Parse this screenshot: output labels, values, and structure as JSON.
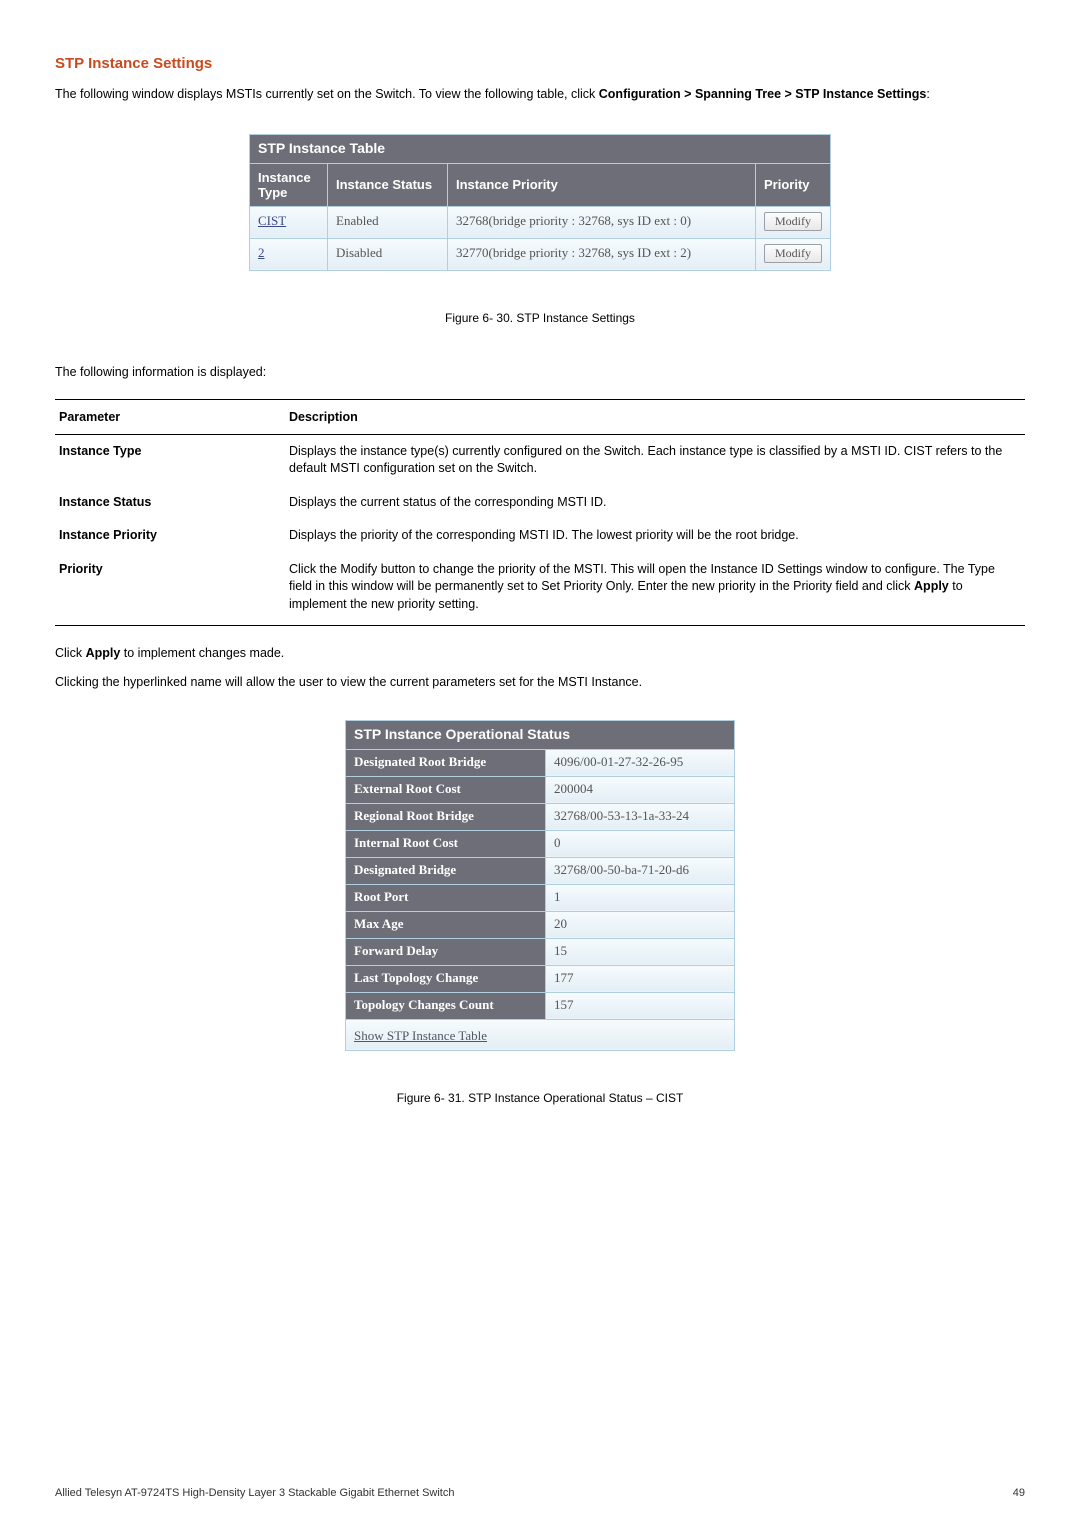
{
  "section": {
    "title": "STP Instance Settings",
    "intro_prefix": "The following window displays MSTIs currently set on the Switch. To view the following table, click ",
    "intro_bold": "Configuration > Spanning Tree > STP Instance Settings",
    "intro_suffix": ":"
  },
  "stp_instance_table": {
    "title": "STP Instance Table",
    "headers": {
      "instance_type": "Instance Type",
      "instance_status": "Instance Status",
      "instance_priority": "Instance Priority",
      "priority": "Priority"
    },
    "rows": [
      {
        "type": "CIST",
        "type_link": true,
        "status": "Enabled",
        "priority_text": "32768(bridge priority : 32768, sys ID ext : 0)",
        "action": "Modify"
      },
      {
        "type": "2",
        "type_link": true,
        "status": "Disabled",
        "priority_text": "32770(bridge priority : 32768, sys ID ext : 2)",
        "action": "Modify"
      }
    ]
  },
  "fig1_caption": "Figure 6- 30. STP Instance Settings",
  "param_intro": "The following information is displayed:",
  "param_table": {
    "headers": {
      "param": "Parameter",
      "desc": "Description"
    },
    "rows": [
      {
        "param": "Instance Type",
        "desc": "Displays the instance type(s) currently configured on the Switch. Each instance type is classified by a MSTI ID. CIST refers to the default MSTI configuration set on the Switch."
      },
      {
        "param": "Instance Status",
        "desc": "Displays the current status of the corresponding MSTI ID."
      },
      {
        "param": "Instance Priority",
        "desc": "Displays the priority of the corresponding MSTI ID. The lowest priority will be the root bridge."
      },
      {
        "param": "Priority",
        "desc_prefix": "Click the Modify button to change the priority of the MSTI. This will open the Instance ID Settings window to configure. The Type field in this window will be permanently set to Set Priority Only. Enter the new priority in the Priority field and click ",
        "desc_bold": "Apply",
        "desc_suffix": " to implement the new priority setting."
      }
    ]
  },
  "after_table": {
    "line1_prefix": "Click ",
    "line1_bold": "Apply",
    "line1_suffix": " to implement changes made.",
    "line2": "Clicking the hyperlinked name will allow the user to view the current parameters set for the MSTI Instance."
  },
  "op_status": {
    "title": "STP Instance Operational Status",
    "rows": [
      {
        "k": "Designated Root Bridge",
        "v": "4096/00-01-27-32-26-95"
      },
      {
        "k": "External Root Cost",
        "v": "200004"
      },
      {
        "k": "Regional Root Bridge",
        "v": "32768/00-53-13-1a-33-24"
      },
      {
        "k": "Internal Root Cost",
        "v": "0"
      },
      {
        "k": "Designated Bridge",
        "v": "32768/00-50-ba-71-20-d6"
      },
      {
        "k": "Root Port",
        "v": "1"
      },
      {
        "k": "Max Age",
        "v": "20"
      },
      {
        "k": "Forward Delay",
        "v": "15"
      },
      {
        "k": "Last Topology Change",
        "v": "177"
      },
      {
        "k": "Topology Changes Count",
        "v": "157"
      }
    ],
    "link_text": "Show STP Instance Table"
  },
  "fig2_caption": "Figure 6- 31. STP Instance Operational Status – CIST",
  "footer": {
    "left": "Allied Telesyn AT-9724TS High-Density Layer 3 Stackable Gigabit Ethernet Switch",
    "right": "49"
  }
}
